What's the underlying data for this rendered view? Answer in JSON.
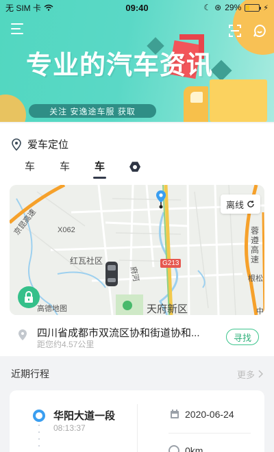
{
  "status_bar": {
    "carrier": "无 SIM 卡",
    "time": "09:40",
    "battery": "29%",
    "battery_level": 0.29
  },
  "banner": {
    "headline": "专业的汽车资讯",
    "promo": "关注 安逸途车服 获取"
  },
  "location_section": {
    "title": "爱车定位",
    "tabs": [
      {
        "label": "车",
        "active": false
      },
      {
        "label": "车",
        "active": false
      },
      {
        "label": "车",
        "active": true
      }
    ],
    "settings_icon": "hexagon-settings-icon"
  },
  "map": {
    "offline_label": "离线",
    "labels": {
      "highway_left": "京昆高速",
      "road_code": "X062",
      "community": "红瓦社区",
      "river": "府河",
      "road_badge": "G213",
      "district": "天府新区",
      "map_brand": "高德地图",
      "highway_right": "蓉遵高速",
      "town": "根松",
      "edge_char": "中"
    }
  },
  "address": {
    "main": "四川省成都市双流区协和街道协和...",
    "distance": "距您约4.57公里",
    "find_button": "寻找"
  },
  "trips": {
    "title": "近期行程",
    "more": "更多",
    "items": [
      {
        "place": "华阳大道一段",
        "time": "08:13:37",
        "date": "2020-06-24",
        "distance": "0km"
      }
    ]
  },
  "colors": {
    "banner_teal": "#52d7c0",
    "accent_green": "#35c08a",
    "trip_blue": "#3a9ef0",
    "road_red": "#e6574f"
  }
}
